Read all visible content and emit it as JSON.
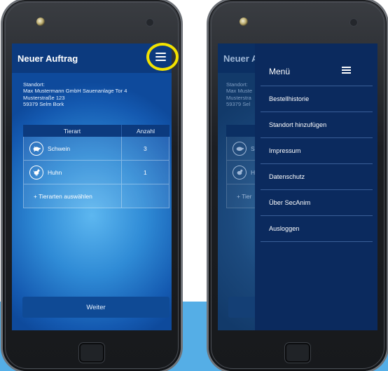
{
  "left_screen": {
    "header": {
      "title": "Neuer Auftrag"
    },
    "location": {
      "label": "Standort:",
      "line1": "Max Mustermann GmbH Sauenanlage Tor 4",
      "line2": "Musterstraße 123",
      "line3": "59379 Selm Bork"
    },
    "table": {
      "col_animal": "Tierart",
      "col_count": "Anzahl",
      "rows": [
        {
          "animal": "Schwein",
          "count": "3",
          "icon": "pig-icon"
        },
        {
          "animal": "Huhn",
          "count": "1",
          "icon": "chicken-icon"
        }
      ],
      "add_label": "+ Tierarten auswählen"
    },
    "next_button": "Weiter"
  },
  "right_screen": {
    "header": {
      "title": "Neuer A"
    },
    "location": {
      "l1": "Standort:",
      "l2": "Max Muste",
      "l3": "Musterstra",
      "l4": "59379 Sel"
    },
    "rows": [
      {
        "partial": "S"
      },
      {
        "partial": "H"
      }
    ],
    "add_partial": "+ Tier",
    "menu": {
      "title": "Menü",
      "items": [
        "Bestellhistorie",
        "Standort hinzufügen",
        "Impressum",
        "Datenschutz",
        "Über SecAnim",
        "Ausloggen"
      ]
    }
  },
  "colors": {
    "highlight": "#f2e200",
    "appbar": "#0c3a7e",
    "background_band": "#55aee6",
    "drawer": "#0b2a5e"
  }
}
